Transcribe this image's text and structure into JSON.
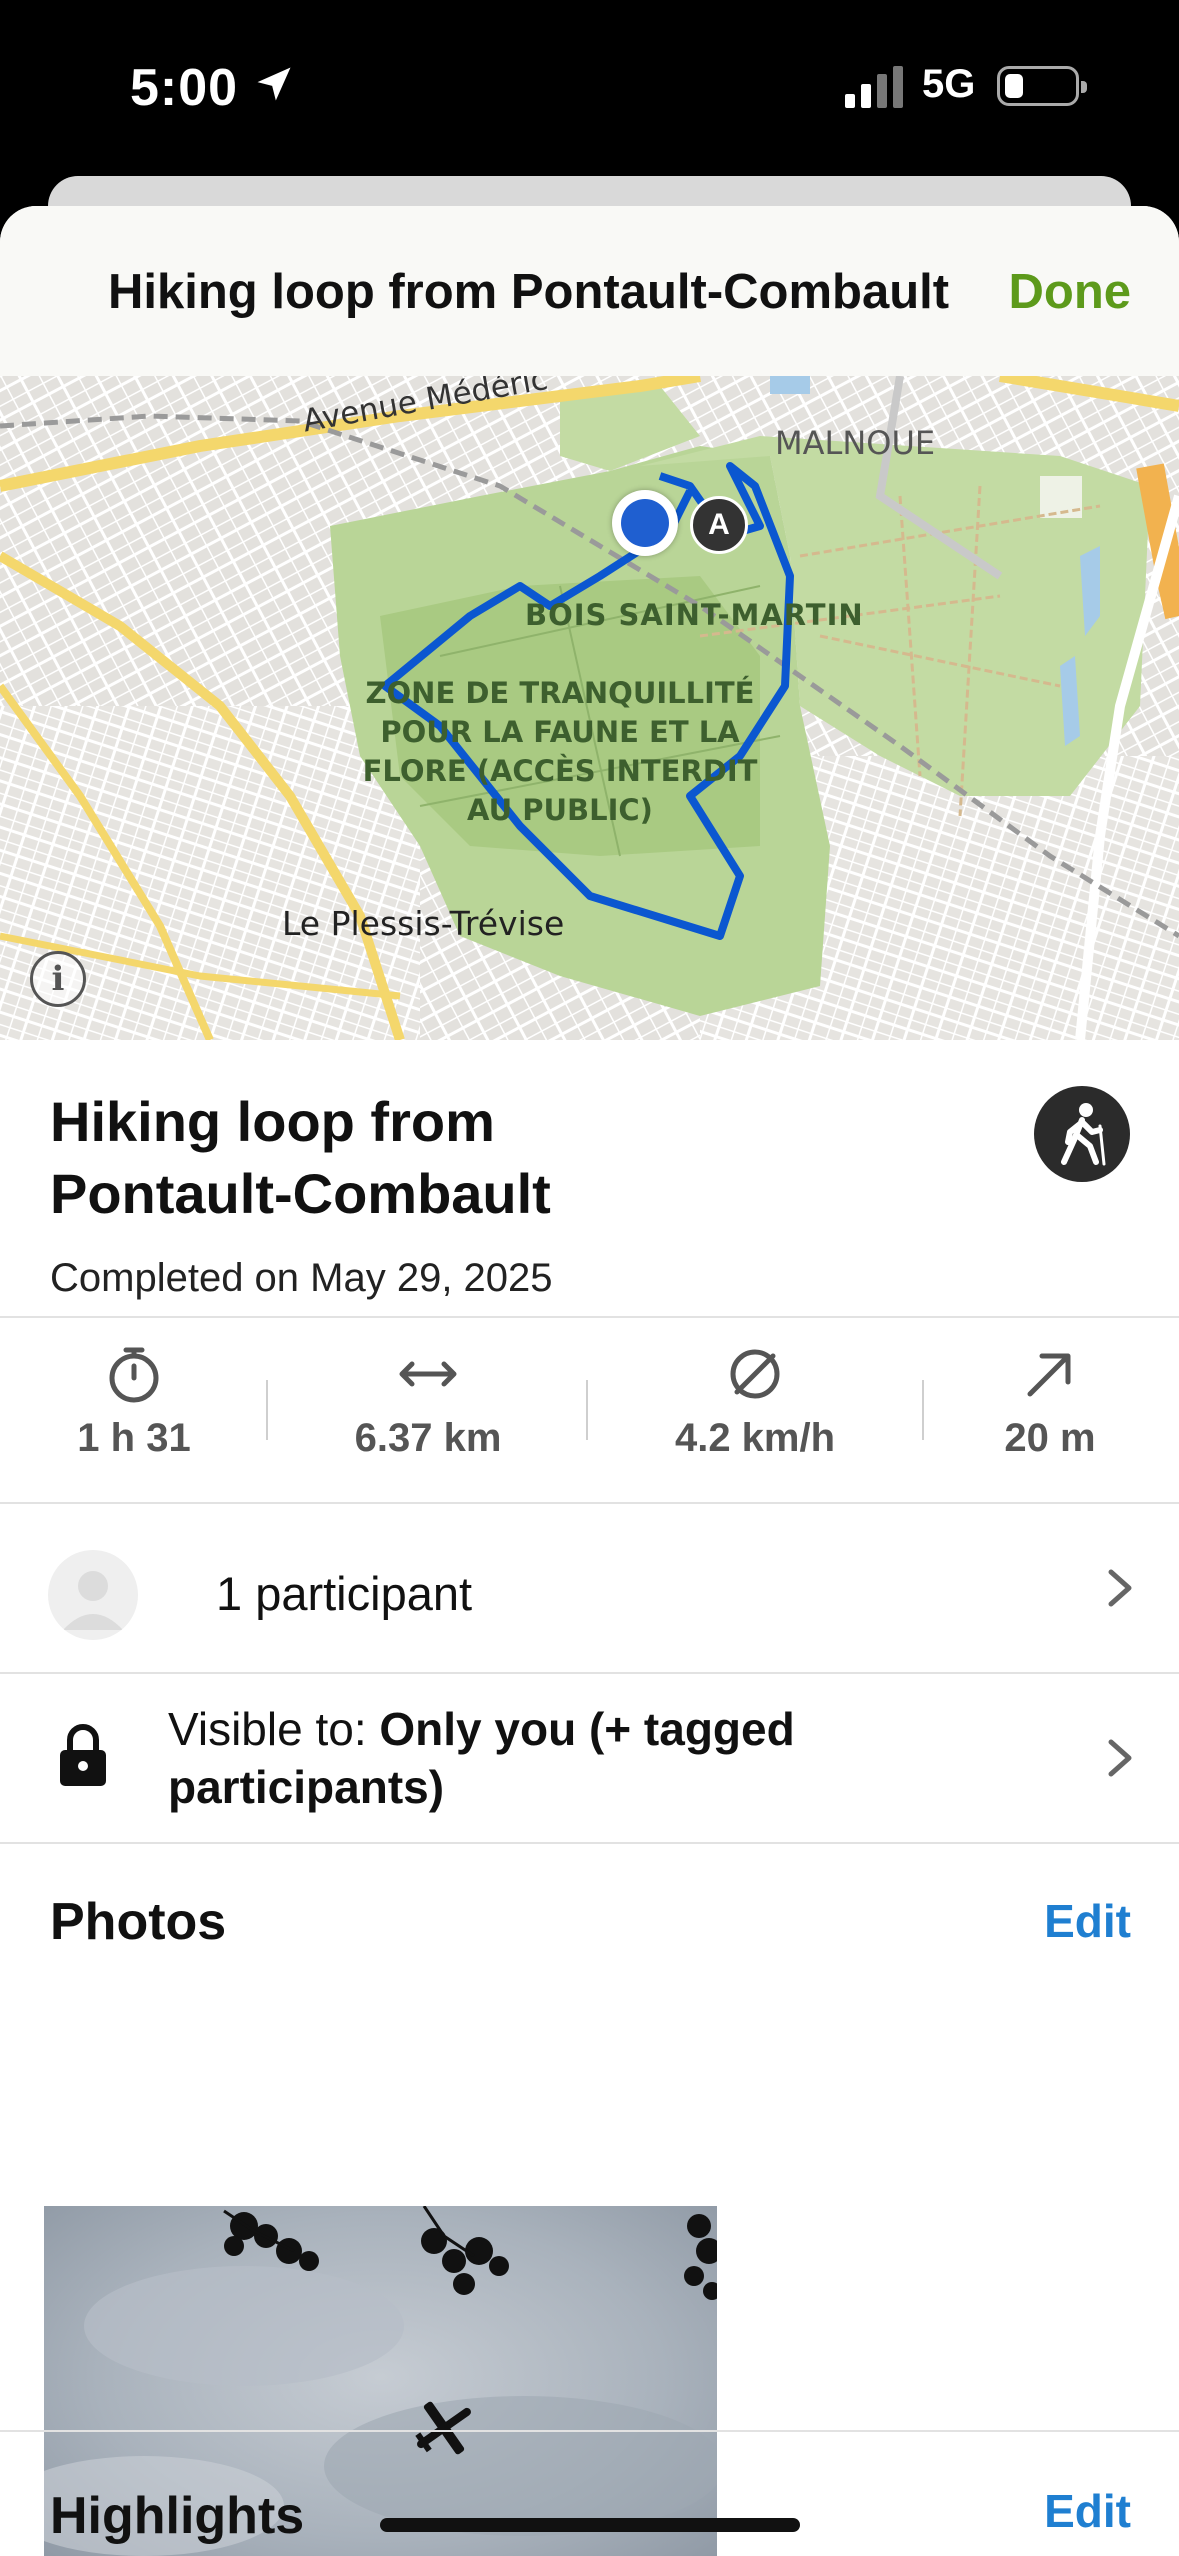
{
  "status_bar": {
    "time": "5:00",
    "network": "5G"
  },
  "header": {
    "title": "Hiking loop from Pontault-Combault",
    "done_label": "Done"
  },
  "map": {
    "labels": {
      "avenue": "Avenue Médéric",
      "malnoue": "MALNOUE",
      "bois": "BOIS SAINT-MARTIN",
      "zone": "ZONE DE TRANQUILLITÉ POUR LA FAUNE ET LA FLORE (ACCÈS INTERDIT AU PUBLIC)",
      "plessis": "Le Plessis-Trévise"
    },
    "start_marker": "A",
    "info_label": "i"
  },
  "activity": {
    "title": "Hiking loop from Pontault-Combault",
    "date": "Completed on May 29, 2025",
    "icon": "hiker-icon"
  },
  "stats": [
    {
      "icon": "stopwatch-icon",
      "value": "1 h 31"
    },
    {
      "icon": "distance-arrows-icon",
      "value": "6.37 km"
    },
    {
      "icon": "average-speed-icon",
      "value": "4.2 km/h"
    },
    {
      "icon": "elevation-gain-icon",
      "value": "20 m"
    }
  ],
  "participants": {
    "label": "1 participant"
  },
  "visibility": {
    "prefix": "Visible to: ",
    "value": "Only you (+ tagged participants)"
  },
  "photos": {
    "title": "Photos",
    "edit_label": "Edit"
  },
  "highlights": {
    "title": "Highlights",
    "edit_label": "Edit"
  },
  "colors": {
    "accent_green": "#5d9a1b",
    "link_blue": "#1f7fd1",
    "route_blue": "#0b57d0"
  }
}
